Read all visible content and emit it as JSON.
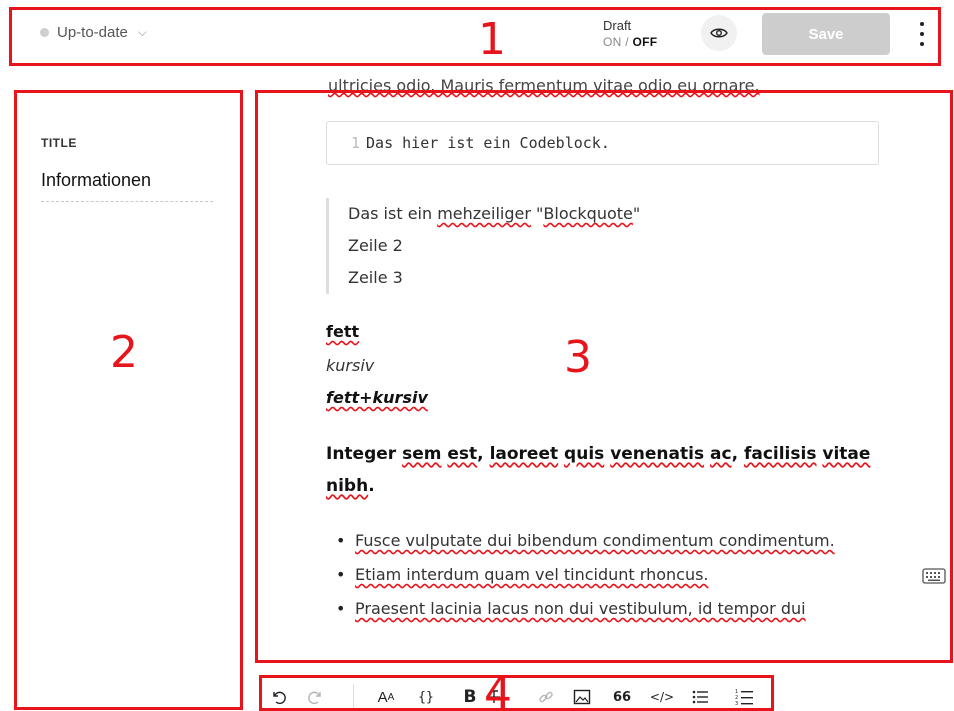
{
  "header": {
    "status_label": "Up-to-date",
    "draft_label": "Draft",
    "draft_on": "ON",
    "draft_separator": "/",
    "draft_off": "OFF",
    "save_label": "Save",
    "preview_icon": "eye-icon",
    "more_icon": "kebab-menu-icon"
  },
  "sidebar": {
    "field_label": "TITLE",
    "title_value": "Informationen"
  },
  "editor": {
    "cut_line": "ultricies odio. Mauris fermentum vitae odio eu ornare.",
    "code_line_number": "1",
    "code_text": "Das hier ist ein Codeblock.",
    "blockquote": {
      "line1_a": "Das ist ein ",
      "line1_b": "mehzeiliger",
      "line1_c": " \"",
      "line1_d": "Blockquote",
      "line1_e": "\"",
      "line2": "Zeile 2",
      "line3": "Zeile 3"
    },
    "bold_text": "fett",
    "italic_text": "kursiv",
    "bold_italic_text": "fett+kursiv",
    "heading": {
      "w1": "Integer ",
      "w2": "sem",
      "w3": " ",
      "w4": "est",
      "w5": ", ",
      "w6": "laoreet",
      "w7": " ",
      "w8": "quis",
      "w9": " ",
      "w10": "venenatis",
      "w11": " ",
      "w12": "ac",
      "w13": ", ",
      "w14": "facilisis",
      "w15": " ",
      "w16": "vitae",
      "w17": " ",
      "w18": "nibh",
      "w19": "."
    },
    "list": [
      "Fusce vulputate dui bibendum condimentum condimentum.",
      "Etiam interdum quam vel tincidunt rhoncus.",
      "Praesent lacinia lacus non dui vestibulum, id tempor dui"
    ]
  },
  "toolbar_icons": [
    "undo-icon",
    "redo-icon",
    "text-size-icon",
    "code-braces-icon",
    "bold-icon",
    "strikethrough-icon",
    "link-icon",
    "image-icon",
    "quote-icon",
    "code-icon",
    "bullet-list-icon",
    "numbered-list-icon"
  ],
  "toolbar_glyphs": {
    "text_size": "A",
    "braces": "{}",
    "bold": "B",
    "quote": "66",
    "code": "</>"
  },
  "annotations": [
    "1",
    "2",
    "3",
    "4"
  ],
  "colors": {
    "annotation": "#e8141b",
    "save_disabled": "#cdcdcd",
    "spellcheck": "#e8141b"
  }
}
